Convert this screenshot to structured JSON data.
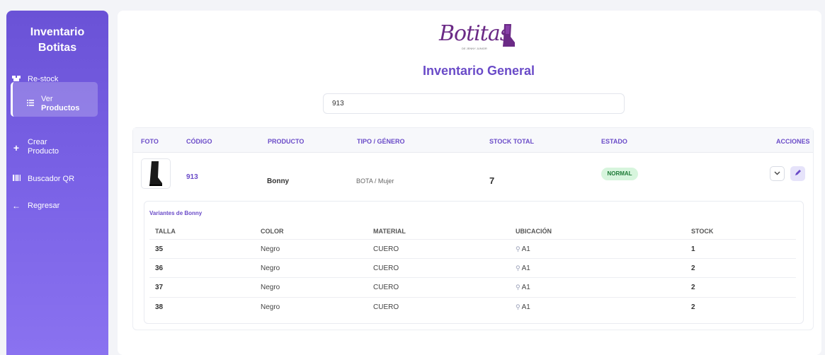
{
  "sidebar": {
    "brand": [
      "Inventario",
      "Botitas"
    ],
    "items": [
      {
        "label": "Re-stock",
        "icon": "boxes-icon"
      },
      {
        "label": [
          "Ver",
          "Productos"
        ],
        "icon": "list-icon",
        "active": true
      },
      {
        "label": [
          "Crear",
          "Producto"
        ],
        "icon": "plus-icon"
      },
      {
        "label": "Buscador QR",
        "icon": "barcode-icon"
      },
      {
        "label": "Regresar",
        "icon": "arrow-left-icon"
      }
    ]
  },
  "header": {
    "logo_text": "Botitas",
    "logo_sub": "DE JENNY JUNIOR",
    "title": "Inventario General"
  },
  "search": {
    "value": "913"
  },
  "table": {
    "headers": [
      "FOTO",
      "CÓDIGO",
      "PRODUCTO",
      "TIPO / GÉNERO",
      "STOCK TOTAL",
      "ESTADO",
      "ACCIONES"
    ],
    "rows": [
      {
        "code": "913",
        "product": "Bonny",
        "type": "BOTA / Mujer",
        "stock": "7",
        "status": "NORMAL"
      }
    ]
  },
  "variants": {
    "title": "Variantes de Bonny",
    "headers": [
      "TALLA",
      "COLOR",
      "MATERIAL",
      "UBICACIÓN",
      "STOCK"
    ],
    "rows": [
      {
        "size": "35",
        "color": "Negro",
        "material": "CUERO",
        "location": "A1",
        "stock": "1"
      },
      {
        "size": "36",
        "color": "Negro",
        "material": "CUERO",
        "location": "A1",
        "stock": "2"
      },
      {
        "size": "37",
        "color": "Negro",
        "material": "CUERO",
        "location": "A1",
        "stock": "2"
      },
      {
        "size": "38",
        "color": "Negro",
        "material": "CUERO",
        "location": "A1",
        "stock": "2"
      }
    ]
  },
  "colors": {
    "accent": "#6a4bc8",
    "sidebar": "#7a62e6",
    "badge_bg": "#d7f5dd",
    "badge_text": "#1d7a36"
  }
}
